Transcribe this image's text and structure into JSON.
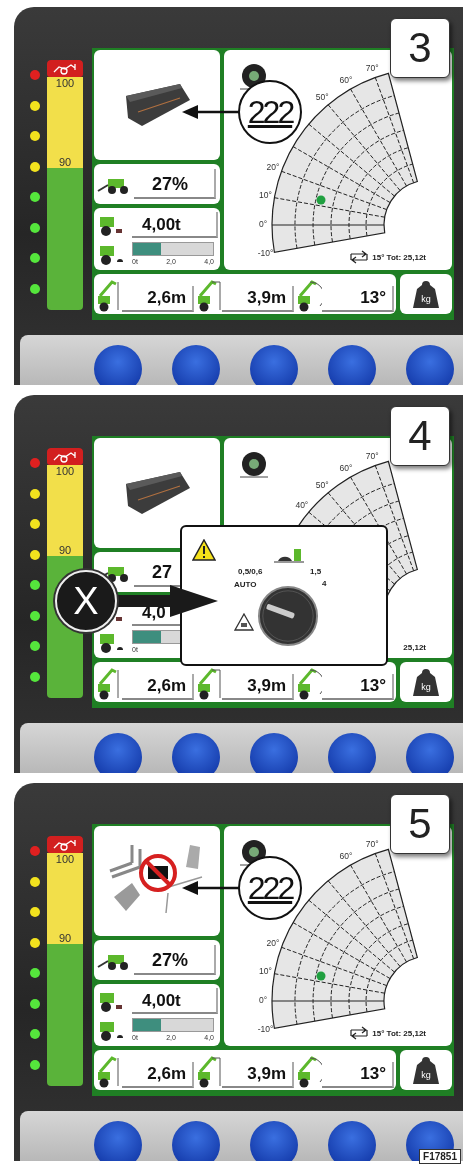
{
  "panels": [
    {
      "number": "3",
      "gauge": {
        "top_label": "100",
        "mid_label": "90"
      },
      "leds": [
        {
          "color": "#e02020"
        },
        {
          "color": "#f2e21e"
        },
        {
          "color": "#f2e21e"
        },
        {
          "color": "#f2e21e"
        },
        {
          "color": "#55e63c"
        },
        {
          "color": "#55e63c"
        },
        {
          "color": "#55e63c"
        },
        {
          "color": "#55e63c"
        }
      ],
      "attachment": {
        "kind": "bucket"
      },
      "tilt": "27%",
      "load": "4,00t",
      "load_bar": {
        "level": 0.35,
        "scale": [
          "0t",
          "2,0",
          "4,0"
        ]
      },
      "chart": {
        "angle_labels": {
          "70": "70°",
          "60": "60°",
          "50": "50°",
          "20": "20°",
          "10": "10°",
          "0": "0°",
          "-10": "-10°"
        },
        "footer": "15° Tot: 25,12t",
        "turn_arrow": true
      },
      "measures": [
        {
          "kind": "height",
          "value": "2,6m"
        },
        {
          "kind": "reach",
          "value": "3,9m"
        },
        {
          "kind": "angle",
          "value": "13°"
        }
      ],
      "kg": "kg",
      "callout": "222"
    },
    {
      "number": "4",
      "gauge": {
        "top_label": "100",
        "mid_label": "90"
      },
      "leds": [
        {
          "color": "#e02020"
        },
        {
          "color": "#f2e21e"
        },
        {
          "color": "#f2e21e"
        },
        {
          "color": "#f2e21e"
        },
        {
          "color": "#55e63c"
        },
        {
          "color": "#55e63c"
        },
        {
          "color": "#55e63c"
        },
        {
          "color": "#55e63c"
        }
      ],
      "attachment": {
        "kind": "bucket"
      },
      "tilt": "27",
      "load": "4,0",
      "load_bar": {
        "level": 0.35,
        "scale": [
          "0t"
        ]
      },
      "chart": {
        "angle_labels": {
          "70": "70°",
          "60": "60°",
          "50": "50°",
          "40": "40°"
        },
        "footer": "25,12t",
        "turn_arrow": false
      },
      "measures": [
        {
          "kind": "height",
          "value": "2,6m"
        },
        {
          "kind": "reach",
          "value": "3,9m"
        },
        {
          "kind": "angle",
          "value": "13°"
        }
      ],
      "kg": "kg",
      "popup": {
        "dial_labels": [
          "0,5/0,6",
          "1,5",
          "AUTO",
          "4"
        ]
      },
      "x_callout": "X"
    },
    {
      "number": "5",
      "gauge": {
        "top_label": "100",
        "mid_label": "90"
      },
      "leds": [
        {
          "color": "#e02020"
        },
        {
          "color": "#f2e21e"
        },
        {
          "color": "#f2e21e"
        },
        {
          "color": "#f2e21e"
        },
        {
          "color": "#55e63c"
        },
        {
          "color": "#55e63c"
        },
        {
          "color": "#55e63c"
        },
        {
          "color": "#55e63c"
        }
      ],
      "attachment": {
        "kind": "forks-prohibited"
      },
      "tilt": "27%",
      "load": "4,00t",
      "load_bar": {
        "level": 0.35,
        "scale": [
          "0t",
          "2,0",
          "4,0"
        ]
      },
      "chart": {
        "angle_labels": {
          "70": "70°",
          "60": "60°",
          "20": "20°",
          "10": "10°",
          "0": "0°",
          "-10": "-10°"
        },
        "footer": "15° Tot: 25,12t",
        "turn_arrow": true
      },
      "measures": [
        {
          "kind": "height",
          "value": "2,6m"
        },
        {
          "kind": "reach",
          "value": "3,9m"
        },
        {
          "kind": "angle",
          "value": "13°"
        }
      ],
      "kg": "kg",
      "callout": "222",
      "figure_code": "F17851"
    }
  ]
}
